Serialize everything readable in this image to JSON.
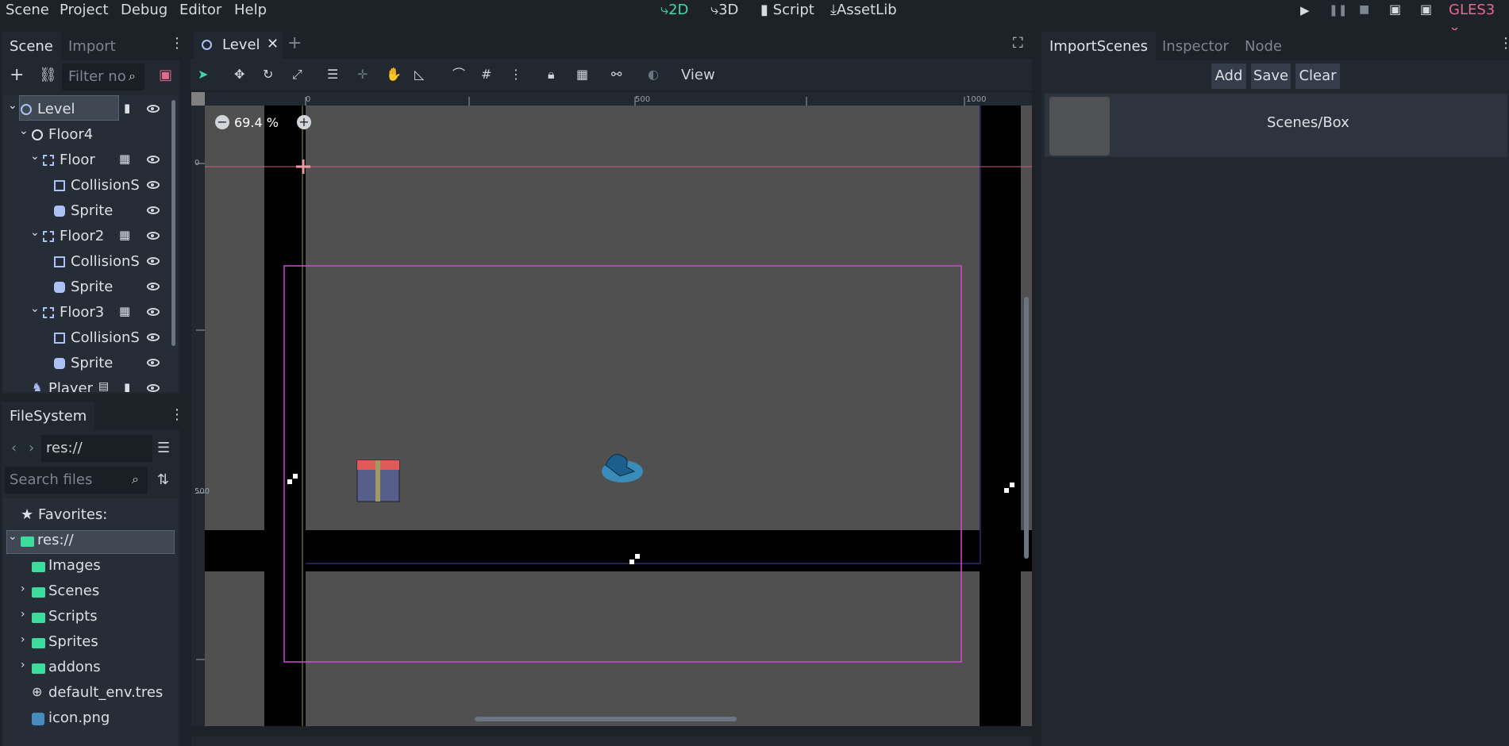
{
  "menu": [
    "Scene",
    "Project",
    "Debug",
    "Editor",
    "Help"
  ],
  "workspaces": {
    "two_d": "2D",
    "three_d": "3D",
    "script": "Script",
    "assetlib": "AssetLib"
  },
  "renderer": "GLES3",
  "scene_dock": {
    "tabs": [
      "Scene",
      "Import"
    ],
    "filter_placeholder": "Filter nodes",
    "tree": [
      {
        "label": "Level",
        "depth": 0,
        "type": "node2d",
        "selected": true,
        "has_script": true,
        "visible": true
      },
      {
        "label": "Floor4",
        "depth": 1,
        "type": "node2d"
      },
      {
        "label": "Floor",
        "depth": 2,
        "type": "staticbody",
        "group": true,
        "visible": true
      },
      {
        "label": "CollisionS",
        "depth": 3,
        "type": "collision",
        "visible": true
      },
      {
        "label": "Sprite",
        "depth": 3,
        "type": "sprite",
        "visible": true
      },
      {
        "label": "Floor2",
        "depth": 2,
        "type": "staticbody",
        "group": true,
        "visible": true
      },
      {
        "label": "CollisionS",
        "depth": 3,
        "type": "collision",
        "visible": true
      },
      {
        "label": "Sprite",
        "depth": 3,
        "type": "sprite",
        "visible": true
      },
      {
        "label": "Floor3",
        "depth": 2,
        "type": "staticbody",
        "group": true,
        "visible": true
      },
      {
        "label": "CollisionS",
        "depth": 3,
        "type": "collision",
        "visible": true
      },
      {
        "label": "Sprite",
        "depth": 3,
        "type": "sprite",
        "visible": true
      },
      {
        "label": "Player",
        "depth": 1,
        "type": "kinematic",
        "visible": true
      }
    ]
  },
  "filesystem": {
    "title": "FileSystem",
    "path": "res://",
    "search_placeholder": "Search files",
    "items": [
      {
        "label": "Favorites:",
        "kind": "favorites"
      },
      {
        "label": "res://",
        "kind": "root"
      },
      {
        "label": "Images",
        "kind": "folder"
      },
      {
        "label": "Scenes",
        "kind": "folder"
      },
      {
        "label": "Scripts",
        "kind": "folder"
      },
      {
        "label": "Sprites",
        "kind": "folder"
      },
      {
        "label": "addons",
        "kind": "folder"
      },
      {
        "label": "default_env.tres",
        "kind": "env"
      },
      {
        "label": "icon.png",
        "kind": "image"
      }
    ]
  },
  "editor": {
    "tab": "Level",
    "zoom": "69.4 %",
    "view_menu": "View",
    "ruler": {
      "h_labels": [
        "0",
        "500",
        "1000"
      ],
      "v_labels": [
        "0",
        "500"
      ]
    }
  },
  "right_dock": {
    "tabs": [
      "ImportScenes",
      "Inspector",
      "Node"
    ],
    "buttons": {
      "add": "Add",
      "save": "Save",
      "clear": "Clear"
    },
    "entry": "Scenes/Box"
  },
  "colors": {
    "accent": "#45d7a8",
    "renderer": "#e26b8d",
    "bg": "#1d2229",
    "panel": "#222830"
  }
}
